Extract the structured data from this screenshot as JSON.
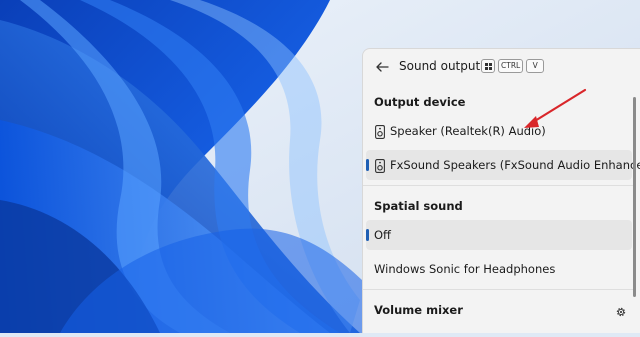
{
  "flyout": {
    "title": "Sound output",
    "shortcut_keys": [
      "CTRL",
      "V"
    ],
    "icons": {
      "back": "back-arrow-icon",
      "windows_key": "windows-key-icon",
      "speaker": "speaker-icon",
      "settings": "gear-icon"
    }
  },
  "output_device": {
    "heading": "Output device",
    "items": [
      {
        "label": "Speaker (Realtek(R) Audio)",
        "selected": false
      },
      {
        "label": "FxSound Speakers (FxSound Audio Enhancer)",
        "selected": true
      }
    ]
  },
  "spatial_sound": {
    "heading": "Spatial sound",
    "items": [
      {
        "label": "Off",
        "selected": true
      },
      {
        "label": "Windows Sonic for Headphones",
        "selected": false
      }
    ]
  },
  "volume_mixer": {
    "heading": "Volume mixer"
  },
  "colors": {
    "accent": "#1f5fb4",
    "annotation_arrow": "#d9262a",
    "wallpaper": "#0b4fd6"
  }
}
